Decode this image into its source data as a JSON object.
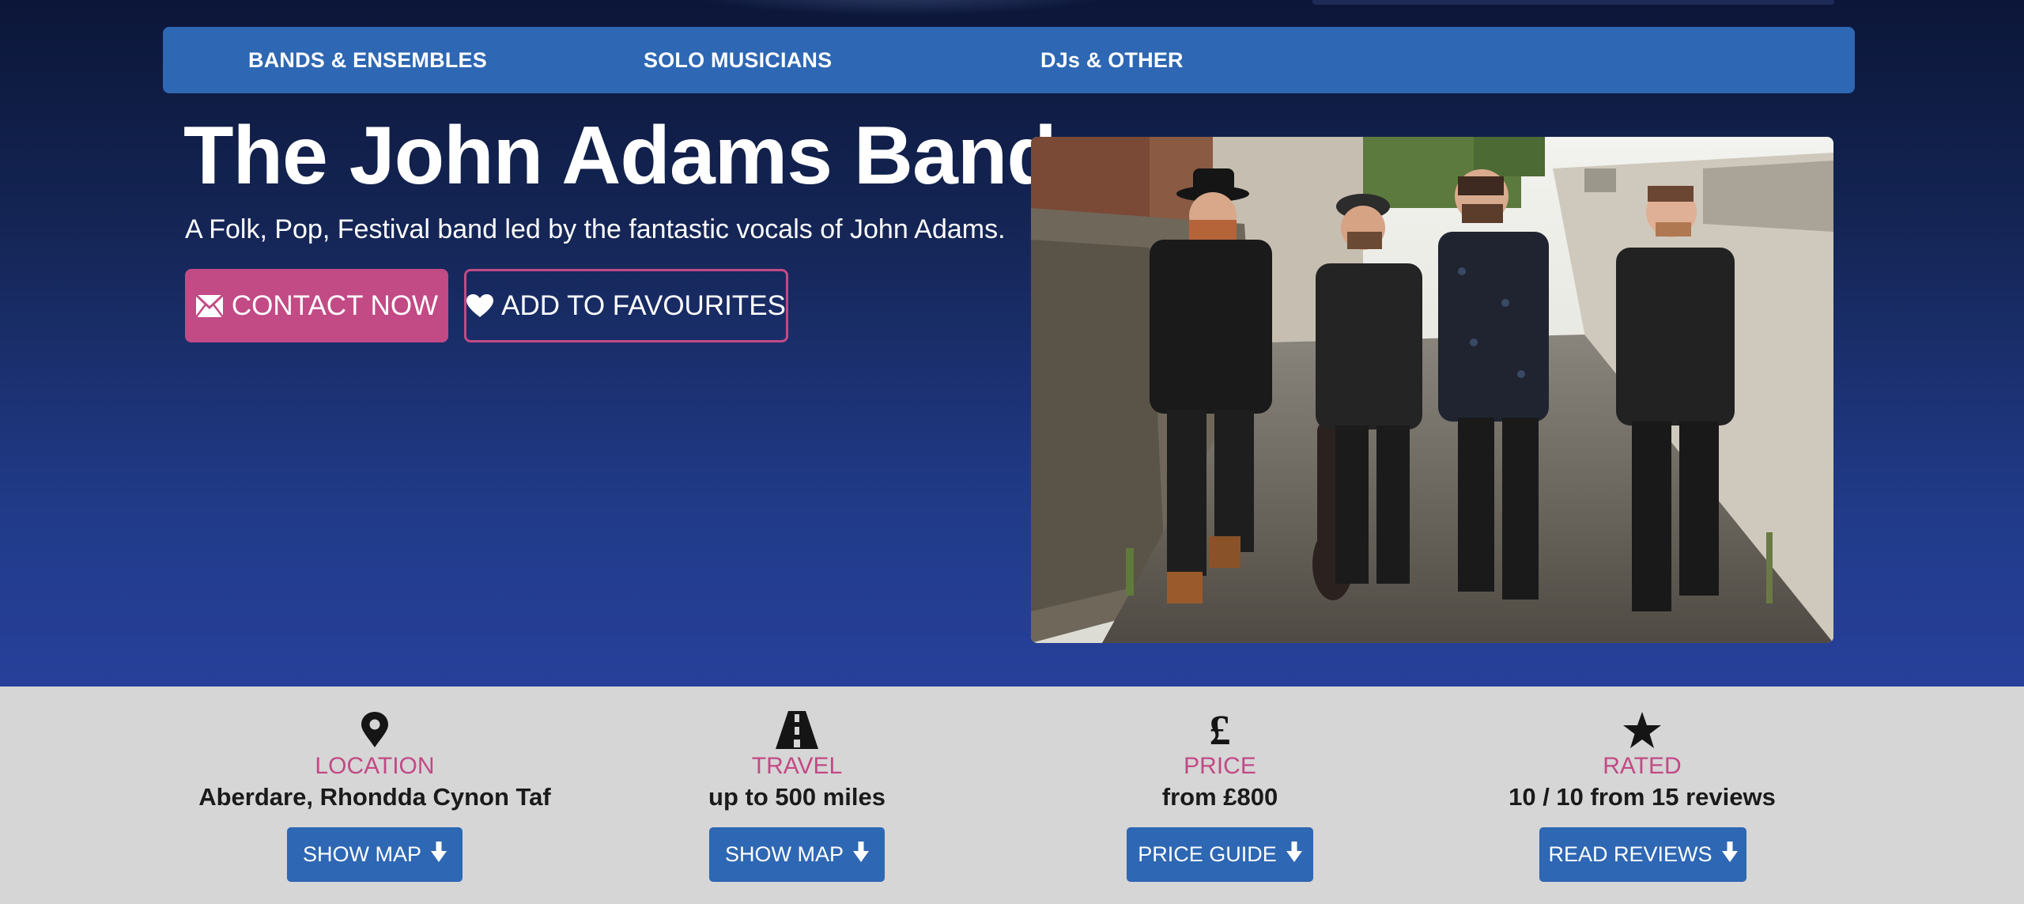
{
  "nav": {
    "items": [
      {
        "label": "BANDS & ENSEMBLES"
      },
      {
        "label": "SOLO MUSICIANS"
      },
      {
        "label": "DJs & OTHER"
      }
    ]
  },
  "hero": {
    "title": "The John Adams Band",
    "subtitle": "A Folk, Pop, Festival band led by the fantastic vocals of John Adams.",
    "contact_label": "CONTACT NOW",
    "favourite_label": "ADD TO FAVOURITES"
  },
  "info": {
    "location": {
      "label": "LOCATION",
      "value": "Aberdare, Rhondda Cynon Taf",
      "button": "SHOW MAP",
      "icon": "map-pin-icon"
    },
    "travel": {
      "label": "TRAVEL",
      "value": "up to 500 miles",
      "button": "SHOW MAP",
      "icon": "road-icon"
    },
    "price": {
      "label": "PRICE",
      "value": "from £800",
      "button": "PRICE GUIDE",
      "icon": "pound-icon"
    },
    "rated": {
      "label": "RATED",
      "value": "10 / 10 from 15 reviews",
      "button": "READ REVIEWS",
      "icon": "star-icon"
    }
  },
  "colors": {
    "accent_pink": "#c24a85",
    "nav_blue": "#2e67b3",
    "hero_dark": "#0b1638",
    "hero_light": "#27409a",
    "info_bg": "#d6d6d6"
  }
}
